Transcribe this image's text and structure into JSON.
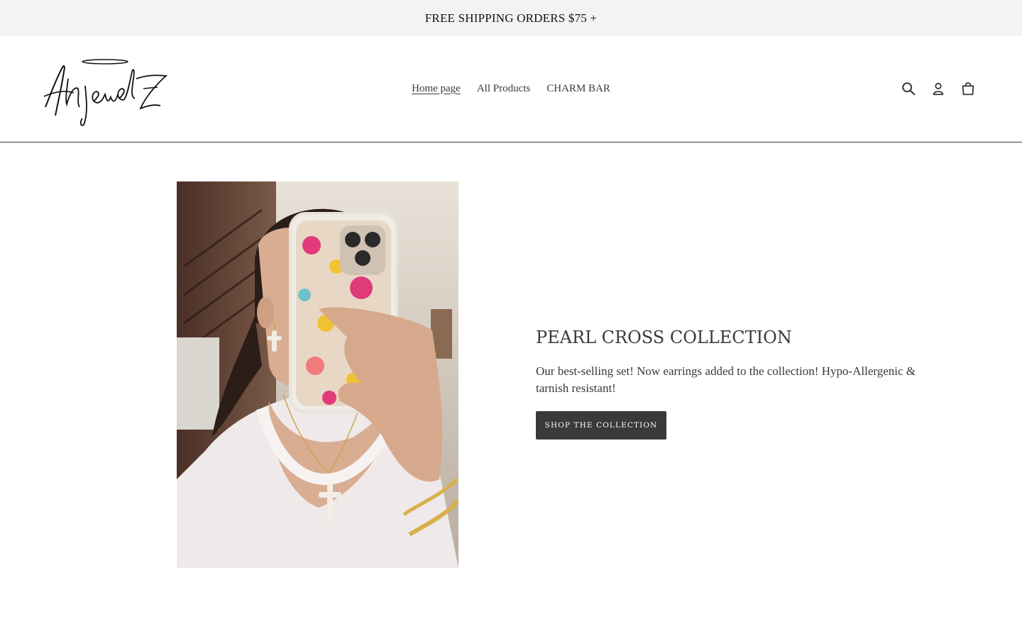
{
  "announcement": {
    "text": "FREE SHIPPING ORDERS $75 +"
  },
  "header": {
    "logo_text": "Anjewelz",
    "nav": [
      {
        "label": "Home page",
        "active": true
      },
      {
        "label": "All Products",
        "active": false
      },
      {
        "label": "CHARM BAR",
        "active": false
      }
    ],
    "icons": [
      "search-icon",
      "account-icon",
      "cart-icon"
    ]
  },
  "hero": {
    "title": "PEARL CROSS COLLECTION",
    "description": "Our best-selling set! Now earrings added to the collection! Hypo-Allergenic & tarnish resistant!",
    "button_label": "SHOP THE COLLECTION"
  },
  "colors": {
    "announcement_bg": "#f3f3f3",
    "text": "#3a3a3a",
    "button_bg": "#3a3a3a",
    "button_text": "#ffffff"
  }
}
